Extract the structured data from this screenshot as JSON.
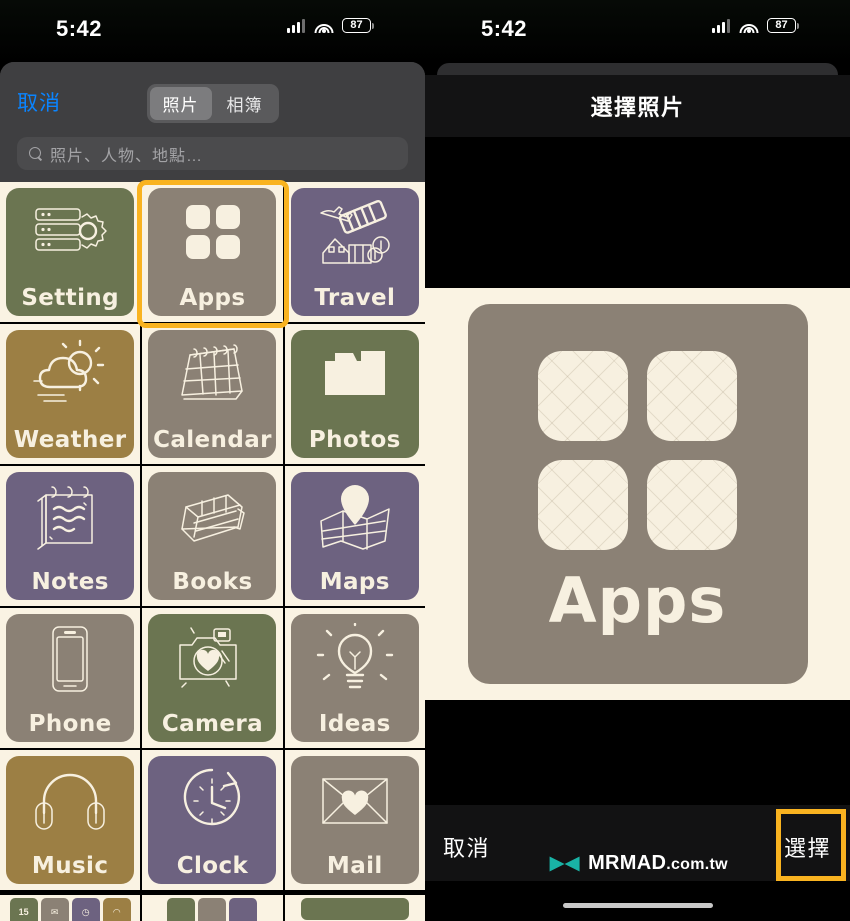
{
  "status_bar": {
    "time": "5:42",
    "battery": "87",
    "wifi_icon": "wifi-icon",
    "signal_icon": "cellular-signal-icon"
  },
  "left_pane": {
    "cancel_label": "取消",
    "segments": [
      {
        "label": "照片",
        "selected": true
      },
      {
        "label": "相簿",
        "selected": false
      }
    ],
    "search": {
      "placeholder": "照片、人物、地點…",
      "value": "",
      "icon": "search-icon"
    },
    "grid": [
      {
        "label": "Setting",
        "color": "#6b7551",
        "art": "server-gear-icon",
        "selected": false
      },
      {
        "label": "Apps",
        "color": "#8b8175",
        "art": "four-squares-icon",
        "selected": true
      },
      {
        "label": "Travel",
        "color": "#6d6280",
        "art": "plane-ticket-icon",
        "selected": false
      },
      {
        "label": "Weather",
        "color": "#9c7f44",
        "art": "sun-cloud-icon",
        "selected": false
      },
      {
        "label": "Calendar",
        "color": "#8b8175",
        "art": "desk-calendar-icon",
        "selected": false
      },
      {
        "label": "Photos",
        "color": "#6b7551",
        "art": "retro-camera-icon",
        "selected": false
      },
      {
        "label": "Notes",
        "color": "#6d6280",
        "art": "notepad-icon",
        "selected": false
      },
      {
        "label": "Books",
        "color": "#8b8175",
        "art": "book-stack-icon",
        "selected": false
      },
      {
        "label": "Maps",
        "color": "#6d6280",
        "art": "map-pin-icon",
        "selected": false
      },
      {
        "label": "Phone",
        "color": "#8b8175",
        "art": "smartphone-icon",
        "selected": false
      },
      {
        "label": "Camera",
        "color": "#6b7551",
        "art": "heart-camera-icon",
        "selected": false
      },
      {
        "label": "Ideas",
        "color": "#8b8175",
        "art": "lightbulb-icon",
        "selected": false
      },
      {
        "label": "Music",
        "color": "#9c7f44",
        "art": "headphones-icon",
        "selected": false
      },
      {
        "label": "Clock",
        "color": "#6d6280",
        "art": "clock-icon",
        "selected": false
      },
      {
        "label": "Mail",
        "color": "#8b8175",
        "art": "heart-envelope-icon",
        "selected": false
      }
    ],
    "partial_row": [
      {
        "color": "#6b7551",
        "art": "calendar-15-icon",
        "text": "15"
      },
      {
        "color": "#8b8175",
        "art": "envelope-icon",
        "text": ""
      },
      {
        "color": "#6d6280",
        "art": "clock-icon",
        "text": ""
      },
      {
        "color": "#9c7f44",
        "art": "headphones-icon",
        "text": ""
      }
    ]
  },
  "right_pane": {
    "title": "選擇照片",
    "preview": {
      "label": "Apps",
      "tile_color": "#8b8175",
      "square_color": "#f7f0e0",
      "squares": 4
    },
    "cancel_label": "取消",
    "select_label": "選擇"
  },
  "watermark": {
    "text": "MRMAD",
    "suffix": ".com.tw",
    "logo_color": "#19b3a6"
  },
  "annotations": {
    "highlight_color": "#f9b320",
    "targets": [
      "apps-tile",
      "select-button"
    ]
  }
}
